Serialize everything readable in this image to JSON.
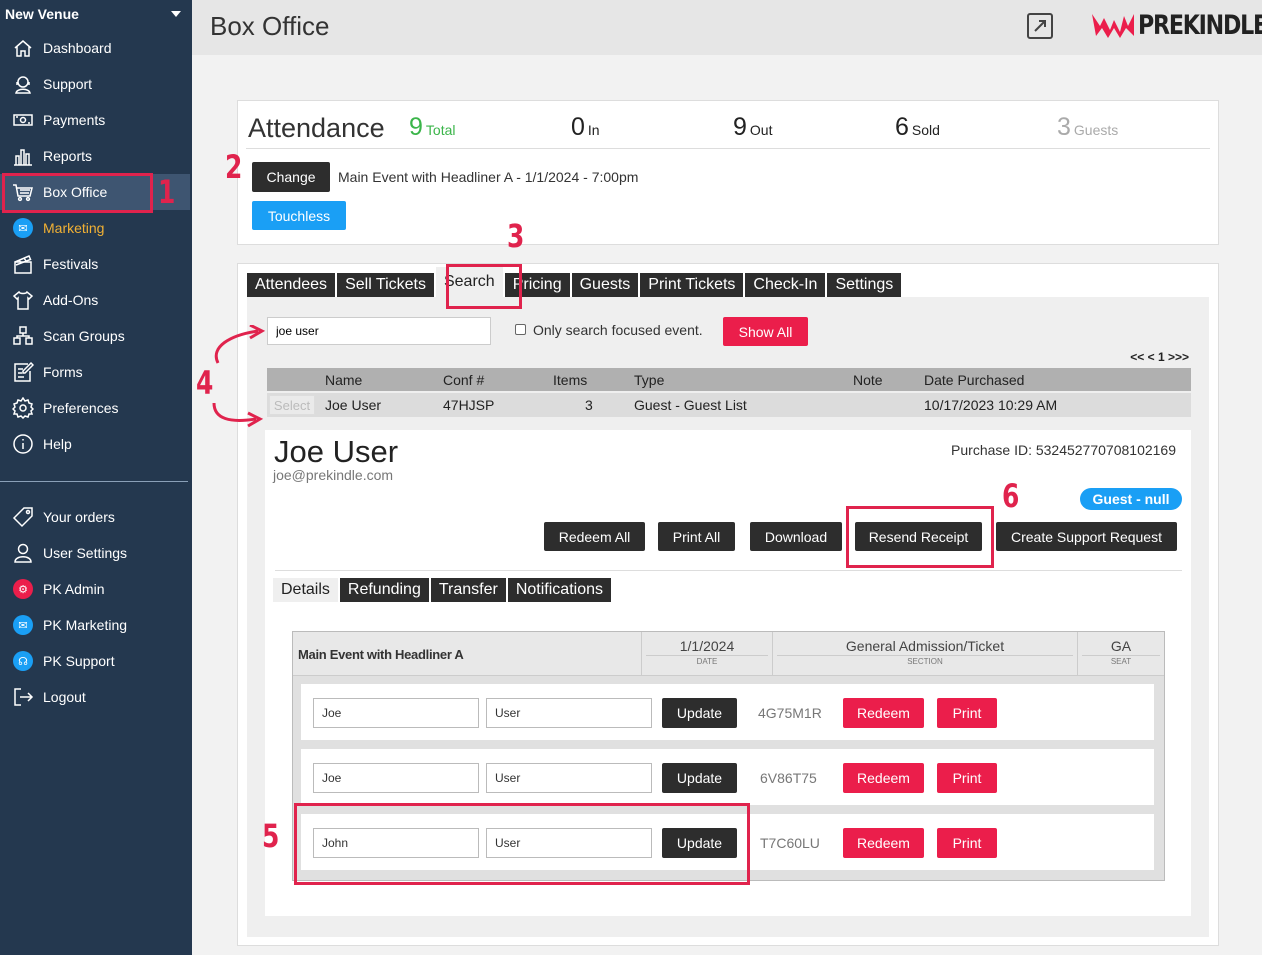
{
  "sidebar": {
    "venue": "New Venue",
    "items": [
      {
        "label": "Dashboard"
      },
      {
        "label": "Support"
      },
      {
        "label": "Payments"
      },
      {
        "label": "Reports"
      },
      {
        "label": "Box Office"
      },
      {
        "label": "Marketing"
      },
      {
        "label": "Festivals"
      },
      {
        "label": "Add-Ons"
      },
      {
        "label": "Scan Groups"
      },
      {
        "label": "Forms"
      },
      {
        "label": "Preferences"
      },
      {
        "label": "Help"
      }
    ],
    "account_items": [
      {
        "label": "Your orders"
      },
      {
        "label": "User Settings"
      },
      {
        "label": "PK Admin"
      },
      {
        "label": "PK Marketing"
      },
      {
        "label": "PK Support"
      },
      {
        "label": "Logout"
      }
    ]
  },
  "header": {
    "title": "Box Office",
    "logo_text": "PREKINDLE"
  },
  "attendance": {
    "title": "Attendance",
    "stats": [
      {
        "value": "9",
        "label": "Total",
        "color": "#3bb54a"
      },
      {
        "value": "0",
        "label": "In",
        "color": "#333333"
      },
      {
        "value": "9",
        "label": "Out",
        "color": "#333333"
      },
      {
        "value": "6",
        "label": "Sold",
        "color": "#333333"
      },
      {
        "value": "3",
        "label": "Guests",
        "color": "#aaaaaa"
      }
    ],
    "change_label": "Change",
    "event_label": "Main Event with Headliner A - 1/1/2024 - 7:00pm",
    "touchless_label": "Touchless"
  },
  "tabs": [
    "Attendees",
    "Sell Tickets",
    "Search",
    "Pricing",
    "Guests",
    "Print Tickets",
    "Check-In",
    "Settings"
  ],
  "search": {
    "query": "joe user",
    "only_focused_label": "Only search focused event.",
    "show_all_label": "Show All",
    "pager": "<< < 1 >>>"
  },
  "results": {
    "columns": [
      "Name",
      "Conf #",
      "Items",
      "Type",
      "Note",
      "Date Purchased"
    ],
    "select_label": "Select",
    "rows": [
      {
        "name": "Joe User",
        "conf": "47HJSP",
        "items": "3",
        "type": "Guest - Guest List",
        "note": "",
        "date": "10/17/2023 10:29 AM"
      }
    ]
  },
  "detail": {
    "name": "Joe User",
    "email": "joe@prekindle.com",
    "purchase_id": "Purchase ID: 532452770708102169",
    "badge": "Guest - null",
    "actions": [
      "Redeem All",
      "Print All",
      "Download",
      "Resend Receipt",
      "Create Support Request"
    ],
    "subtabs": [
      "Details",
      "Refunding",
      "Transfer",
      "Notifications"
    ],
    "ticket_group": {
      "event": "Main Event with Headliner A",
      "date": "1/1/2024",
      "date_label": "DATE",
      "section": "General Admission/Ticket",
      "section_label": "SECTION",
      "seat": "GA",
      "seat_label": "SEAT"
    },
    "update_label": "Update",
    "redeem_label": "Redeem",
    "print_label": "Print",
    "tickets": [
      {
        "first": "Joe",
        "last": "User",
        "code": "4G75M1R"
      },
      {
        "first": "Joe",
        "last": "User",
        "code": "6V86T75"
      },
      {
        "first": "John",
        "last": "User",
        "code": "T7C60LU"
      }
    ]
  },
  "annotations": [
    "1",
    "2",
    "3",
    "4",
    "5",
    "6"
  ],
  "colors": {
    "sidebar": "#24384f",
    "accent_red": "#eb1e4b",
    "accent_blue": "#1a9ff5",
    "annotation": "#e0234d"
  }
}
